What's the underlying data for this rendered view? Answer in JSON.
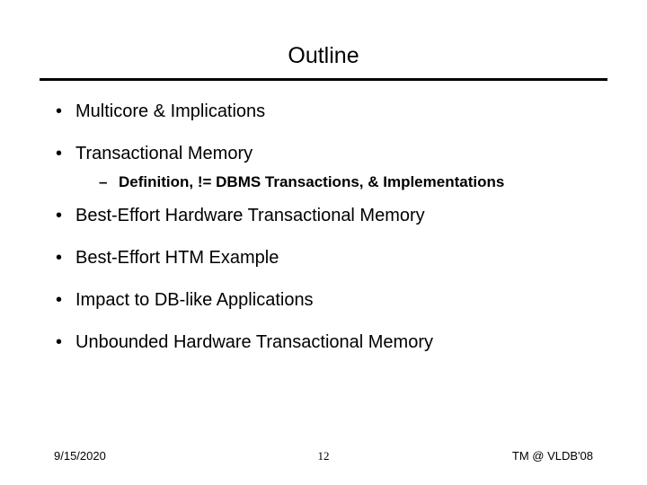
{
  "title": "Outline",
  "bullets": [
    {
      "text": "Multicore & Implications",
      "sub": null
    },
    {
      "text": "Transactional Memory",
      "sub": "Definition, != DBMS Transactions, & Implementations"
    },
    {
      "text": "Best-Effort Hardware Transactional Memory",
      "sub": null
    },
    {
      "text": "Best-Effort HTM Example",
      "sub": null
    },
    {
      "text": "Impact to DB-like Applications",
      "sub": null
    },
    {
      "text": "Unbounded Hardware Transactional Memory",
      "sub": null
    }
  ],
  "footer": {
    "date": "9/15/2020",
    "page": "12",
    "venue": "TM @ VLDB'08"
  }
}
